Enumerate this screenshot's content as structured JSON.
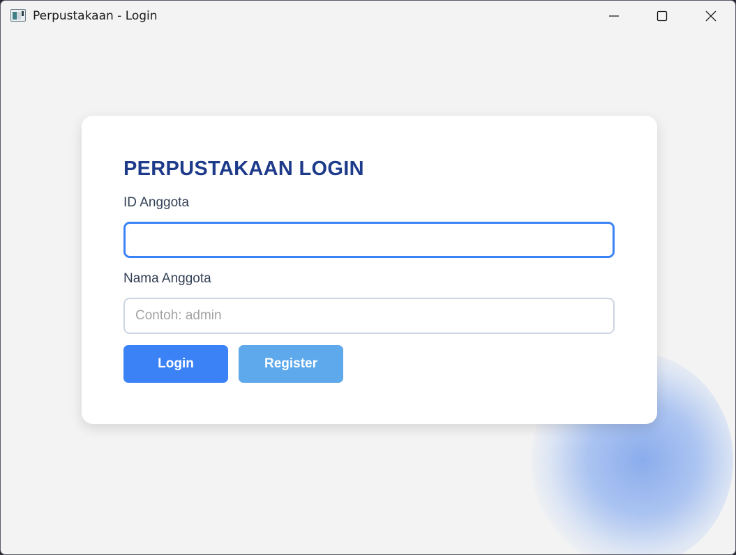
{
  "window": {
    "title": "Perpustakaan - Login",
    "controls": {
      "minimize_icon": "minimize-icon",
      "maximize_icon": "maximize-icon",
      "close_icon": "close-icon"
    }
  },
  "login": {
    "heading": "PERPUSTAKAAN LOGIN",
    "id_field": {
      "label": "ID Anggota",
      "value": "",
      "placeholder": ""
    },
    "name_field": {
      "label": "Nama Anggota",
      "value": "",
      "placeholder": "Contoh: admin"
    },
    "buttons": {
      "login": "Login",
      "register": "Register"
    }
  },
  "colors": {
    "heading": "#1e3a8a",
    "login_button": "#3b82f6",
    "register_button": "#5ea8ec",
    "focus_border": "#3b82f6",
    "background": "#f3f3f3"
  }
}
